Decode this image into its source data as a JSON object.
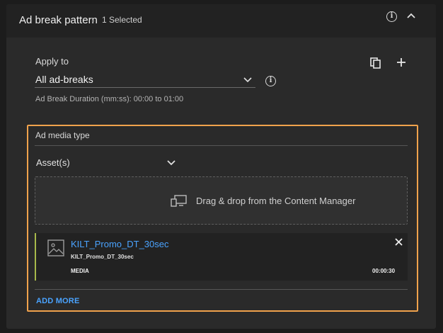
{
  "header": {
    "title": "Ad break pattern",
    "selected_text": "1 Selected",
    "icons": {
      "info": "info-icon",
      "collapse": "chevron-up-icon"
    }
  },
  "apply": {
    "label": "Apply to",
    "selected_value": "All ad-breaks",
    "duration_text": "Ad Break Duration (mm:ss): 00:00 to 01:00",
    "icons": {
      "copy": "copy-icon",
      "add": "plus-icon",
      "info": "info-icon",
      "dropdown": "chevron-down-icon"
    }
  },
  "ad_media": {
    "label": "Ad media type",
    "type_value": "Asset(s)",
    "drop_text": "Drag & drop from the Content Manager",
    "items": [
      {
        "title": "KILT_Promo_DT_30sec",
        "subtitle": "KILT_Promo_DT_30sec",
        "kind": "MEDIA",
        "duration": "00:00:30"
      }
    ],
    "add_more_label": "ADD MORE"
  },
  "colors": {
    "highlight_border": "#f0a24c",
    "link": "#4aa3ff",
    "item_accent": "#a7b94a"
  }
}
